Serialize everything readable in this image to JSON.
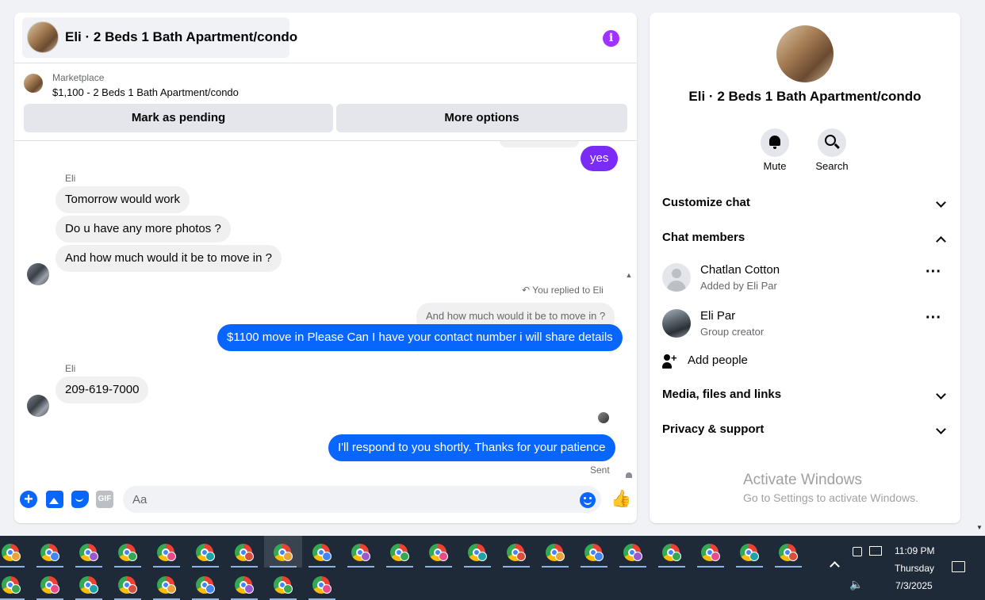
{
  "header": {
    "title": "Eli · 2 Beds 1 Bath Apartment/condo"
  },
  "listing": {
    "source": "Marketplace",
    "title": "$1,100 - 2 Beds 1 Bath Apartment/condo"
  },
  "actions": {
    "pending_label": "Mark as pending",
    "options_label": "More options"
  },
  "messages": {
    "first_out": "yes",
    "sender_1": "Eli",
    "in_1": "Tomorrow would work",
    "in_2": "Do u have any more photos ?",
    "in_3": "And how much would it be to move in ?",
    "reply_note": "You replied to Eli",
    "quoted": "And how much would it be to move in ?",
    "out_reply": "$1100 move in Please Can I have your contact number i will share details",
    "sender_2": "Eli",
    "in_4": "209-619-7000",
    "out_last": "I'll respond to you shortly. Thanks for your patience",
    "status": "Sent"
  },
  "composer": {
    "placeholder": "Aa",
    "gif_label": "GIF"
  },
  "info_panel": {
    "title": "Eli · 2 Beds 1 Bath Apartment/condo",
    "mute_label": "Mute",
    "search_label": "Search",
    "sections": {
      "customize": "Customize chat",
      "members": "Chat members",
      "media": "Media, files and links",
      "privacy": "Privacy & support"
    },
    "members": [
      {
        "name": "Chatlan Cotton",
        "sub": "Added by Eli Par"
      },
      {
        "name": "Eli Par",
        "sub": "Group creator"
      }
    ],
    "add_people": "Add people"
  },
  "watermark": {
    "title": "Activate Windows",
    "subtitle": "Go to Settings to activate Windows."
  },
  "taskbar": {
    "time": "11:09 PM",
    "day": "Thursday",
    "date": "7/3/2025",
    "badge_colors": [
      "#e8a33a",
      "#4285f4",
      "#9b59d0",
      "#34a853",
      "#e74c8c",
      "#1fa3a8",
      "#d94f3d"
    ]
  },
  "colors": {
    "accent": "#0866ff",
    "accent_purple": "#7a2bf5",
    "info_icon": "#a033ff"
  }
}
